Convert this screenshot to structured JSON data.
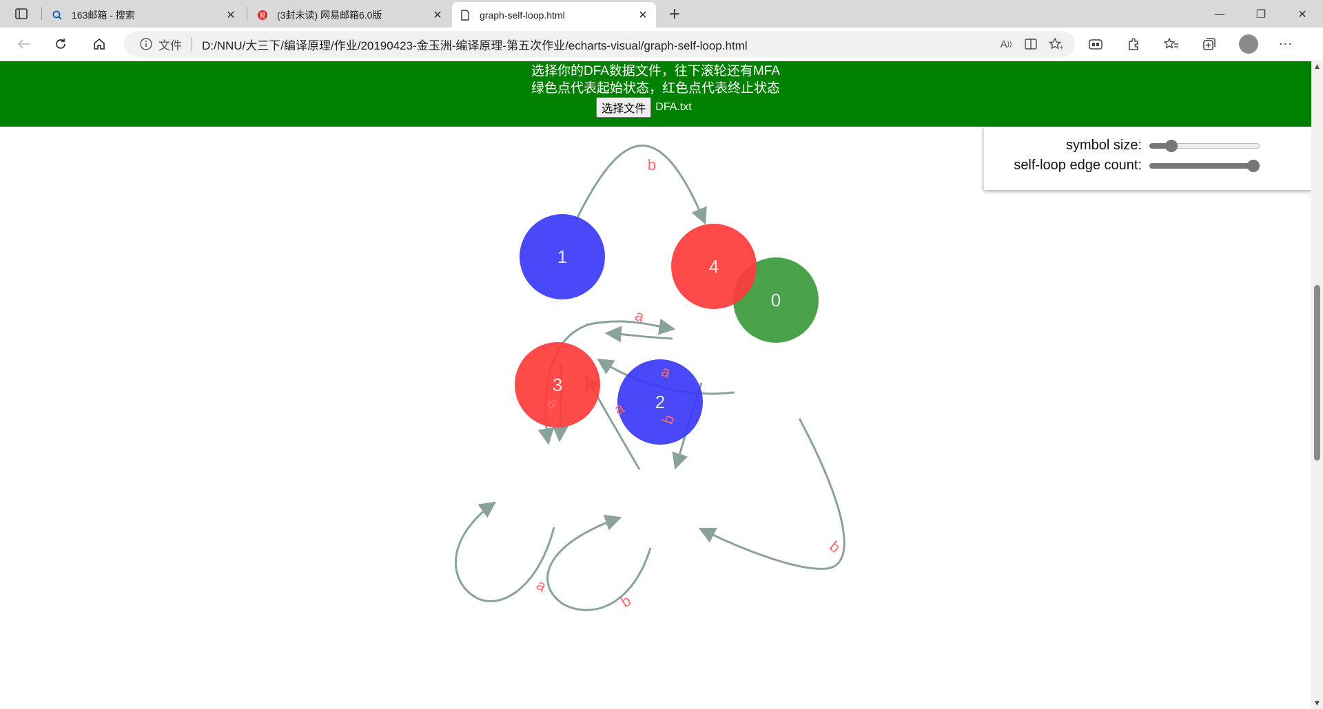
{
  "browser": {
    "tabs": [
      {
        "title": "163邮箱 - 搜索",
        "icon": "search-icon",
        "active": false
      },
      {
        "title": "(3封未读) 网易邮箱6.0版",
        "icon": "netease-mail-icon",
        "active": false
      },
      {
        "title": "graph-self-loop.html",
        "icon": "page-icon",
        "active": true
      }
    ],
    "address": {
      "scheme_label": "文件",
      "url": "D:/NNU/大三下/编译原理/作业/20190423-金玉洲-编译原理-第五次作业/echarts-visual/graph-self-loop.html"
    }
  },
  "page": {
    "banner_line1": "选择你的DFA数据文件，往下滚轮还有MFA",
    "banner_line2": "绿色点代表起始状态，红色点代表终止状态",
    "file_button": "选择文件",
    "file_name": "DFA.txt",
    "banner_color": "#008000",
    "controls": {
      "symbol_size_label": "symbol size:",
      "symbol_size_value": 0.2,
      "selfloop_label": "self-loop edge count:",
      "selfloop_value": 1.0
    }
  },
  "graph": {
    "colors": {
      "start": "#3a9a3a",
      "normal": "#3a3af8",
      "final": "#ff3b3b",
      "edge": "#8aa399",
      "edge_label": "#ff6b6b"
    },
    "nodes": [
      {
        "id": "0",
        "label": "0",
        "type": "start"
      },
      {
        "id": "1",
        "label": "1",
        "type": "normal"
      },
      {
        "id": "2",
        "label": "2",
        "type": "normal"
      },
      {
        "id": "3",
        "label": "3",
        "type": "final"
      },
      {
        "id": "4",
        "label": "4",
        "type": "final"
      }
    ],
    "edges": [
      {
        "from": "1",
        "to": "4",
        "label": "b"
      },
      {
        "from": "1",
        "to": "4",
        "label": "a"
      },
      {
        "from": "4",
        "to": "1",
        "label": ""
      },
      {
        "from": "0",
        "to": "1",
        "label": "a"
      },
      {
        "from": "1",
        "to": "3",
        "label": ""
      },
      {
        "from": "1",
        "to": "3",
        "label": "a"
      },
      {
        "from": "2",
        "to": "1",
        "label": "a"
      },
      {
        "from": "4",
        "to": "2",
        "label": "b"
      },
      {
        "from": "0",
        "to": "2",
        "label": "b"
      },
      {
        "from": "3",
        "to": "3",
        "label": "a"
      },
      {
        "from": "2",
        "to": "2",
        "label": "b"
      }
    ]
  }
}
